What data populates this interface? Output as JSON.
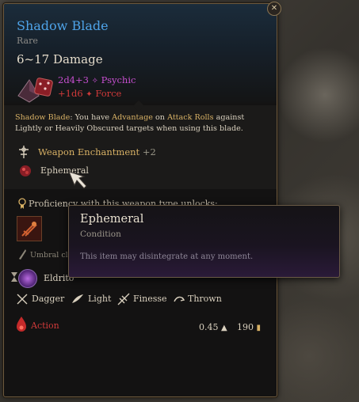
{
  "item": {
    "name": "Shadow Blade",
    "rarity": "Rare",
    "damage_range": "6~17 Damage",
    "damage_lines": [
      {
        "formula": "2d4+3",
        "type": "Psychic",
        "color": "#c74fd0"
      },
      {
        "formula": "+1d6",
        "type": "Force",
        "color": "#d13a3a"
      }
    ],
    "passive": {
      "name": "Shadow Blade",
      "text_1": "You have",
      "kw_1": "Advantage",
      "text_2": "on",
      "kw_2": "Attack Rolls",
      "text_3": "against Lightly or Heavily Obscured targets when using this blade."
    },
    "enchantment": {
      "label": "Weapon Enchantment",
      "bonus": "+2"
    },
    "condition": "Ephemeral",
    "proficiency_text": "Proficiency with this weapon type unlocks:",
    "umbral_text": "Umbral cl",
    "eldritch_text": "Eldrito",
    "properties": [
      "Dagger",
      "Light",
      "Finesse",
      "Thrown"
    ],
    "action_label": "Action",
    "weight": "0.45",
    "price": "190"
  },
  "tooltip": {
    "title": "Ephemeral",
    "subtitle": "Condition",
    "description": "This item may disintegrate at any moment."
  },
  "colors": {
    "title": "#4ea3e8",
    "keyword": "#d8b165",
    "psychic": "#c74fd0",
    "force": "#d13a3a"
  },
  "icons": [
    "close-icon",
    "dice-icon",
    "enchantment-icon",
    "ephemeral-icon",
    "proficiency-icon",
    "skill-icon",
    "umbral-icon",
    "eldritch-icon",
    "dagger-icon",
    "light-icon",
    "finesse-icon",
    "thrown-icon",
    "action-icon",
    "weight-icon",
    "gold-icon",
    "cursor-icon"
  ]
}
